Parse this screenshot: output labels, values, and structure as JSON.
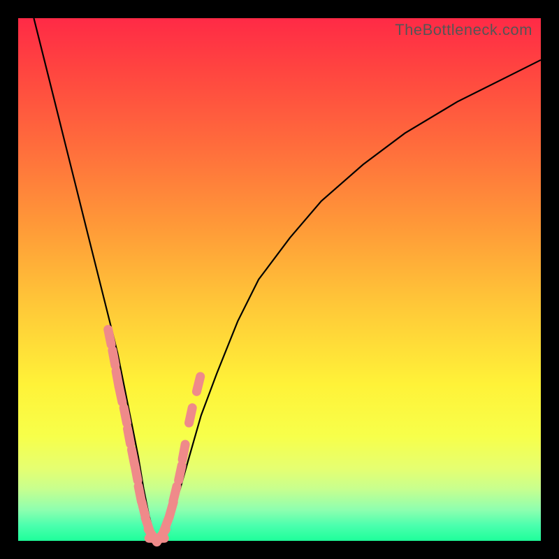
{
  "watermark": "TheBottleneck.com",
  "chart_data": {
    "type": "line",
    "title": "",
    "xlabel": "",
    "ylabel": "",
    "xlim": [
      0,
      100
    ],
    "ylim": [
      0,
      100
    ],
    "series": [
      {
        "name": "bottleneck-curve",
        "x": [
          3,
          5,
          7,
          9,
          11,
          13,
          15,
          17,
          19,
          21,
          22,
          23,
          24,
          25,
          26,
          27,
          28,
          29,
          31,
          33,
          35,
          38,
          42,
          46,
          52,
          58,
          66,
          74,
          84,
          94,
          100
        ],
        "y": [
          100,
          92,
          84,
          76,
          68,
          60,
          52,
          44,
          36,
          26,
          21,
          16,
          10,
          5,
          1,
          0,
          1,
          4,
          10,
          17,
          24,
          32,
          42,
          50,
          58,
          65,
          72,
          78,
          84,
          89,
          92
        ]
      }
    ],
    "highlight_points": {
      "name": "highlight-segment",
      "x": [
        17.5,
        18.3,
        19.0,
        19.6,
        20.5,
        21.2,
        22.0,
        22.6,
        23.3,
        24.0,
        24.8,
        25.7,
        26.5,
        27.4,
        28.3,
        29.3,
        30.0,
        31.0,
        31.7,
        33.0,
        34.5
      ],
      "y": [
        39,
        35,
        31,
        28,
        24,
        20,
        16,
        13,
        9,
        6,
        3,
        1,
        0.5,
        1,
        3,
        6,
        9,
        13,
        17,
        24,
        30
      ]
    },
    "colors": {
      "curve": "#000000",
      "highlight": "#ef8a8a",
      "gradient_top": "#ff2a46",
      "gradient_bottom": "#1eff9a"
    }
  }
}
